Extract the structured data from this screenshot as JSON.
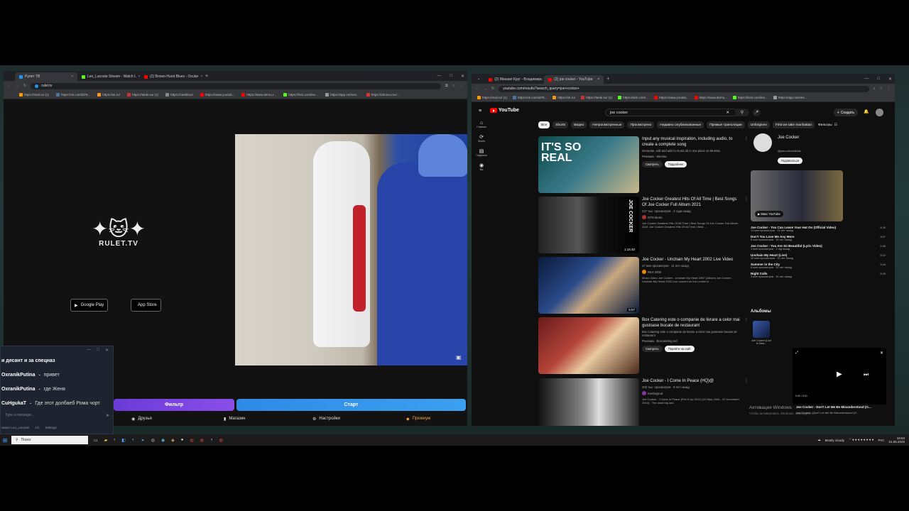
{
  "left_browser": {
    "tabs": [
      {
        "label": "Рулет ТВ",
        "color": "#2196f3",
        "active": true
      },
      {
        "label": "Leo_Lacoste Stream - Watch L",
        "color": "#53fc18",
        "active": false
      },
      {
        "label": "(2) Brown-Hurst Blues - Ocular",
        "color": "#ff0000",
        "active": false
      }
    ],
    "url": "rulet.tv",
    "bookmarks": [
      "https://mail.ru/ (1)",
      "https://vk.com/id75...",
      "https://ok.ru/",
      "https://tanki.su/ (1)",
      "https://ceebbus/",
      "https://www.youtub...",
      "https://www.iternu.r...",
      "https://kick.com/leo...",
      "https://app.ns/mes...",
      "https://2domo.mo/..."
    ],
    "logo_text": "RULET.TV",
    "google_play": "Google Play",
    "app_store": "App Store",
    "filter_button": "Фильтр",
    "start_button": "Старт",
    "footer": {
      "friends": "Друзья",
      "shop": "Магазин",
      "settings": "Настройки",
      "premium": "Премиум"
    }
  },
  "chat": {
    "messages": [
      {
        "user": "",
        "text": "и десант и за спецназ"
      },
      {
        "user": "OxranikPutina",
        "text": "привет"
      },
      {
        "user": "OxranikPutina",
        "text": "где Женя"
      },
      {
        "user": "CuHgukaT",
        "text": "Где этот долбаеб Рома чорт"
      }
    ],
    "input_placeholder": "Type a message...",
    "footer_channel": "канал Leo_Lacoste",
    "footer_count": "1/1",
    "footer_settings": "Settings"
  },
  "right_browser": {
    "tabs": [
      {
        "label": "(2) Михаил Круг - Владимирс",
        "color": "#ff0000",
        "active": false
      },
      {
        "label": "(2) joe cocker - YouTube",
        "color": "#ff0000",
        "active": true
      }
    ],
    "url": "youtube.com/results?search_query=joe+cocker+",
    "bookmarks": [
      "https://mail.ru/ (1)",
      "https://vk.com/id75...",
      "https://ok.ru/",
      "https://tanki.su/ (1)",
      "https://kick.com/...",
      "https://www.youtub...",
      "https://www.iternu...",
      "https://kick.com/leo...",
      "https://app.ns/mes..."
    ],
    "search_query": "joe cocker",
    "create": "Создать",
    "nav": [
      "Главная",
      "Shorts",
      "Подписки",
      "Вы"
    ],
    "chips": [
      "Все",
      "Shorts",
      "Видео",
      "Непросмотренные",
      "Просмотрено",
      "Недавно опубликованные",
      "Прямые трансляции",
      "Unforgiven",
      "First we take manhattan"
    ],
    "filters": "Фильтры",
    "videos": [
      {
        "title": "Input any musical inspiration, including audio, to create a complete song",
        "meta": "Generate, edit and add AI music all in one place on Mureka",
        "channel": "Реклама · Mureka",
        "thumb_text": "IT'S SO REAL",
        "pill1": "Смотреть",
        "pill2": "Подробнее",
        "duration": ""
      },
      {
        "title": "Joe Cocker Greatest Hits Of All Time | Best Songs Of Joe Cocker Full Album 2021",
        "meta": "217 тыс. просмотров · 4 года назад",
        "channel": "NTN Music",
        "desc": "Joe Cocker Greatest Hits Of All Time | Best Songs Of Joe Cocker Full Album 2021 Joe Cocker Greatest Hits Of All Time | Best ...",
        "thumb_text": "JOE COCKER",
        "duration": "1:15:40"
      },
      {
        "title": "Joe Cocker - Unchain My Heart 2002 Live Video",
        "meta": "47 млн просмотров · 11 лет назад",
        "channel": "REX 2000",
        "desc": "Music Video Joe Cocker - Unchain My Heart 1987 (Album) Joe Cocker - Unchain My Heart 2002 Live concert on the Lorelei in ...",
        "thumb_text": "",
        "duration": "5:57"
      },
      {
        "title": "Box Catering este o companie de livrare a celor mai gustoase bucate de restaurant",
        "meta": "Box Catering este o companie de livrare a celor mai gustoase bucate de restaurant",
        "channel": "Реклама · Boxcatering.md",
        "thumb_text": "",
        "pill1": "Смотреть",
        "pill2": "Перейти на сайт",
        "duration": ""
      },
      {
        "title": "Joe Cocker - I Come In Peace (HQ)@",
        "meta": "203 тыс. просмотров · 9 лет назад",
        "channel": "Keeboyjrod",
        "desc": "Joe Cocker - I Come In Peace (Fire It Up 2012) (20 May 1944 - 22 December 2014) - The most big one.",
        "thumb_text": "",
        "duration": ""
      }
    ],
    "channel_panel": {
      "name": "Joe Cocker",
      "handle": "@joecockerofficial",
      "subscribe": "Подписаться",
      "mix_label": "Микс YouTube"
    },
    "tracks": [
      {
        "title": "Joe Cocker - You Can Leave Your Hat On (Official Video)",
        "meta": "13 млн просмотров · 15 лет назад",
        "dur": "4:30"
      },
      {
        "title": "Don't You Love Me Any More",
        "meta": "6 млн просмотров · 15 лет назад",
        "dur": "3:57"
      },
      {
        "title": "Joe Cocker - You Are So Beautiful (Lyric Video)",
        "meta": "1 млн просмотров · 1 год назад",
        "dur": "2:46"
      },
      {
        "title": "Unchain My Heart (Live)",
        "meta": "10 млн просмотров · 15 лет назад",
        "dur": "5:22"
      },
      {
        "title": "Summer in the City",
        "meta": "6 млн просмотров · 15 лет назад",
        "dur": "3:44"
      },
      {
        "title": "Night Calls",
        "meta": "3 млн просмотров · 15 лет назад",
        "dur": "3:29"
      }
    ],
    "albums_heading": "Альбомы",
    "album": "Joe Cocker (Live In New..."
  },
  "miniplayer": {
    "time": "0:00 / 0:00",
    "title": "Joe Cocker - Don't Let Me Be Misunderstood (O...",
    "sub": "Joe Cocker · Don't Let Me Be Misunderstood (O..."
  },
  "activation": {
    "title": "Активация Windows",
    "sub": "Чтобы активировать Windows, перейдите в..."
  },
  "taskbar": {
    "search": "Поиск",
    "weather": "Mostly cloudy",
    "lang": "РУС",
    "time": "18:53",
    "date": "01.05.2025"
  }
}
